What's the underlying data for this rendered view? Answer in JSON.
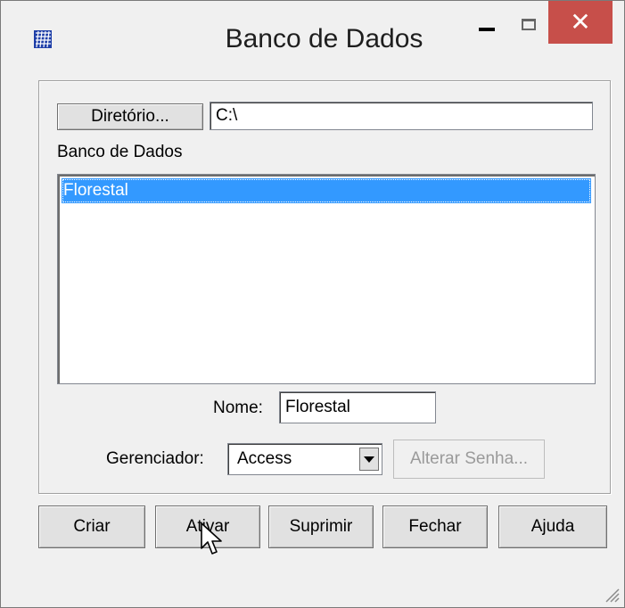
{
  "window": {
    "title": "Banco de Dados",
    "close_glyph": "✕"
  },
  "directory": {
    "button_label": "Diretório...",
    "path_value": "C:\\"
  },
  "database_list": {
    "label": "Banco de Dados",
    "items": [
      "Florestal"
    ],
    "selected_index": 0,
    "selection_color": "#3399ff"
  },
  "name_field": {
    "label": "Nome:",
    "value": "Florestal"
  },
  "manager": {
    "label": "Gerenciador:",
    "selected": "Access",
    "change_password_label": "Alterar Senha..."
  },
  "actions": {
    "create": "Criar",
    "activate": "Ativar",
    "delete": "Suprimir",
    "close": "Fechar",
    "help": "Ajuda"
  },
  "colors": {
    "close_button": "#c74f4a",
    "dialog_bg": "#f0f0f0"
  },
  "icons": {
    "app": "database-grid-icon",
    "cursor": "mouse-pointer-icon",
    "resize": "resize-grip-icon"
  }
}
